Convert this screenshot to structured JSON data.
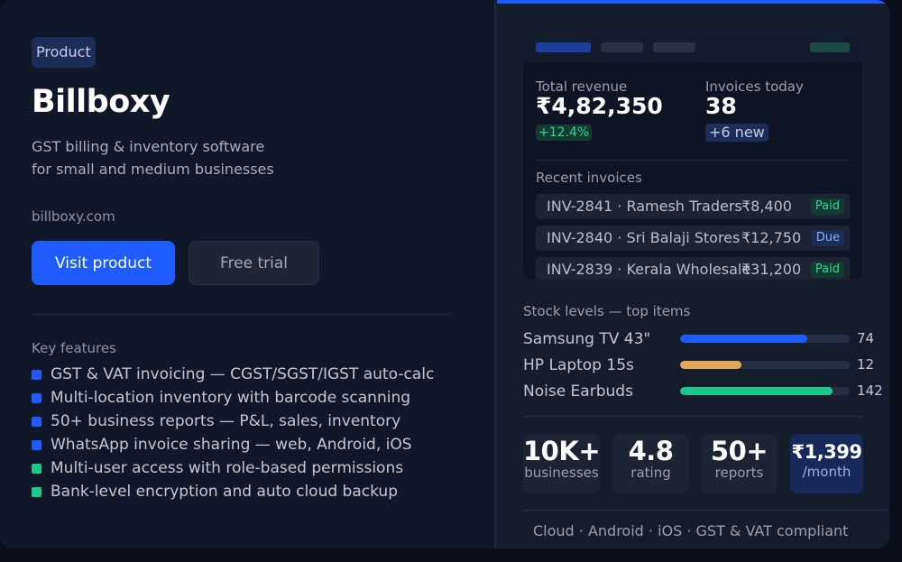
{
  "product": {
    "badge": "Product",
    "name": "Billboxy",
    "tagline_line1": "GST billing & inventory software",
    "tagline_line2": "for small and medium businesses",
    "domain": "billboxy.com",
    "primary_action": "Visit product",
    "secondary_action": "Free trial"
  },
  "features": {
    "title": "Key features",
    "items": [
      {
        "label": "GST & VAT invoicing — CGST/SGST/IGST auto-calc",
        "color": "#1f5cff"
      },
      {
        "label": "Multi-location inventory with barcode scanning",
        "color": "#1f5cff"
      },
      {
        "label": "50+ business reports — P&L, sales, inventory",
        "color": "#1f5cff"
      },
      {
        "label": "WhatsApp invoice sharing — web, Android, iOS",
        "color": "#1f5cff"
      },
      {
        "label": "Multi-user access with role-based permissions",
        "color": "#19c98b"
      },
      {
        "label": "Bank-level encryption and auto cloud backup",
        "color": "#19c98b"
      }
    ]
  },
  "dashboard": {
    "revenue_label": "Total revenue",
    "revenue_value": "₹4,82,350",
    "revenue_delta": "+12.4%",
    "invoices_label": "Invoices today",
    "invoices_value": "38",
    "invoices_delta": "+6 new",
    "recent_title": "Recent invoices",
    "invoices": [
      {
        "text": "INV-2841 · Ramesh Traders",
        "amount": "₹8,400",
        "status": "Paid"
      },
      {
        "text": "INV-2840 · Sri Balaji Stores",
        "amount": "₹12,750",
        "status": "Due"
      },
      {
        "text": "INV-2839 · Kerala Wholesale",
        "amount": "₹31,200",
        "status": "Paid"
      }
    ]
  },
  "stock": {
    "title": "Stock levels — top items",
    "items": [
      {
        "name": "Samsung TV 43\"",
        "qty": "74",
        "level": 0.75,
        "color": "#1f5cff"
      },
      {
        "name": "HP Laptop 15s",
        "qty": "12",
        "level": 0.36,
        "color": "#e0a85a"
      },
      {
        "name": "Noise Earbuds",
        "qty": "142",
        "level": 0.9,
        "color": "#19c98b"
      }
    ]
  },
  "stats": [
    {
      "value": "10K+",
      "label": "businesses"
    },
    {
      "value": "4.8",
      "label": "rating"
    },
    {
      "value": "50+",
      "label": "reports"
    },
    {
      "value": "₹1,399",
      "label": "/month"
    }
  ],
  "footer": "Cloud · Android · iOS · GST & VAT compliant"
}
